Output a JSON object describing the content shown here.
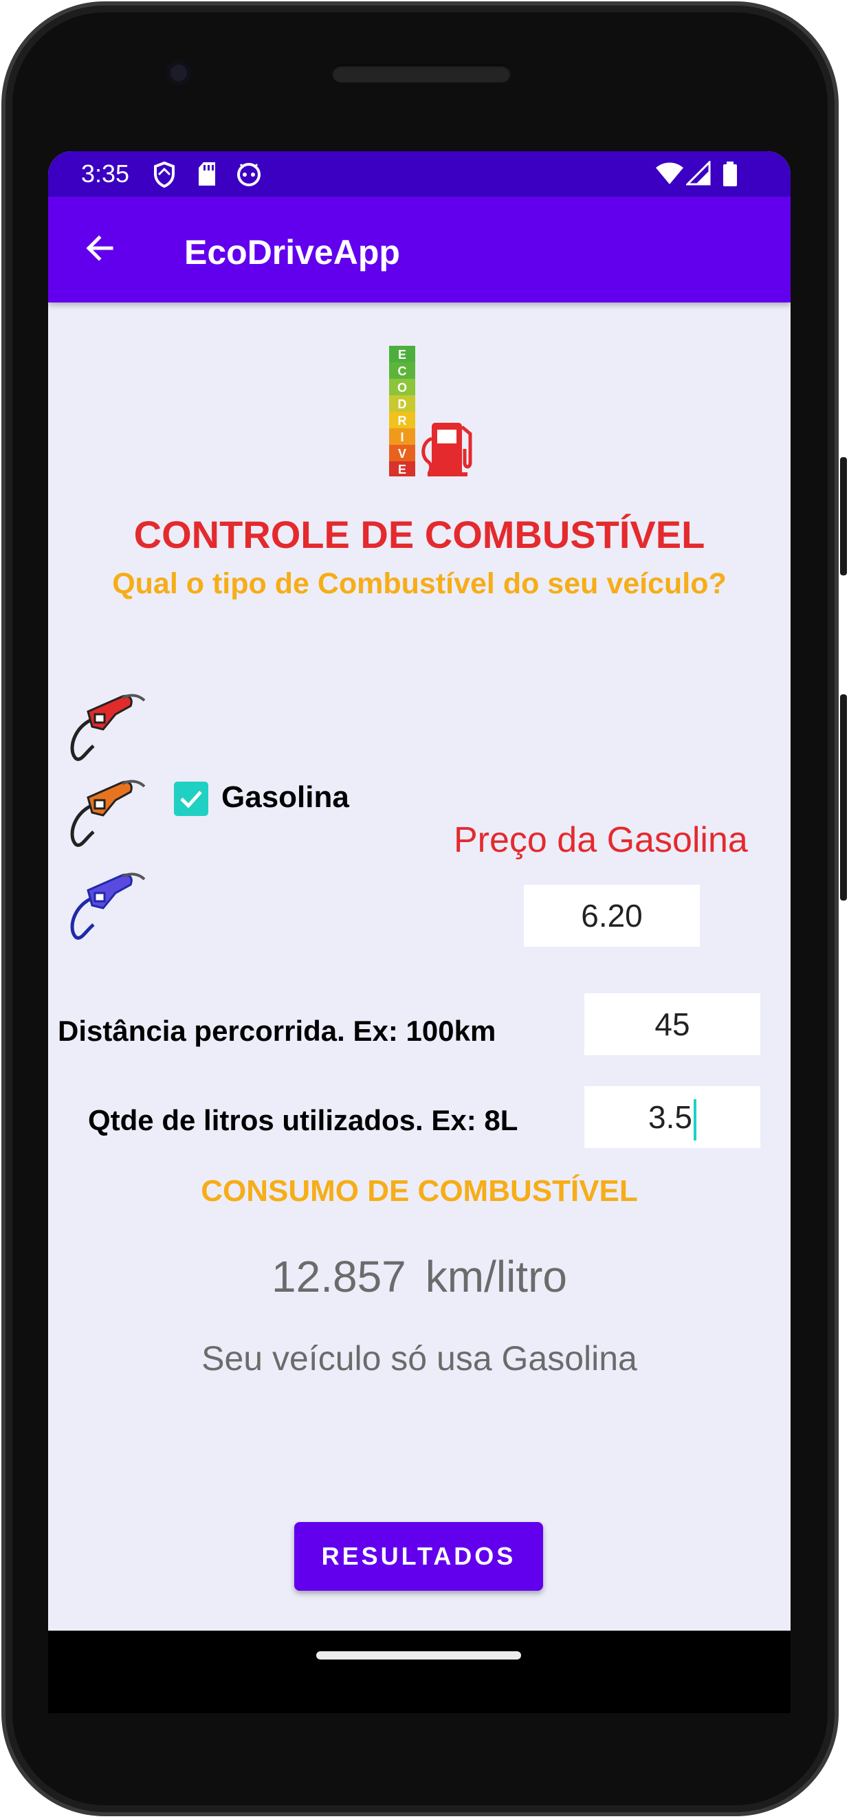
{
  "status_bar": {
    "time": "3:35",
    "left_icons": [
      "shield-icon",
      "sd-card-icon",
      "android-face-icon"
    ],
    "right_icons": [
      "wifi-icon",
      "signal-icon",
      "battery-icon"
    ]
  },
  "app_bar": {
    "title": "EcoDriveApp",
    "back_icon": "arrow-back-icon"
  },
  "logo": {
    "text": "ECODRIVE",
    "letters": [
      "E",
      "C",
      "O",
      "D",
      "R",
      "I",
      "V",
      "E"
    ],
    "icon": "fuel-pump-icon"
  },
  "header": {
    "title": "CONTROLE DE COMBUSTÍVEL",
    "subtitle": "Qual o tipo de Combustível do seu veículo?"
  },
  "fuel_options": {
    "nozzle_colors": [
      "#e02b2b",
      "#e8731f",
      "#5b4ae0"
    ],
    "selected": {
      "label": "Gasolina",
      "checked": true
    }
  },
  "price": {
    "label": "Preço da Gasolina",
    "value": "6.20"
  },
  "distance": {
    "label": "Distância percorrida. Ex: 100km",
    "value": "45"
  },
  "liters": {
    "label": "Qtde de litros utilizados. Ex: 8L",
    "value": "3.5"
  },
  "consumption": {
    "title": "CONSUMO DE COMBUSTÍVEL",
    "value": "12.857",
    "unit": "km/litro",
    "note": "Seu veículo só usa Gasolina"
  },
  "results_button": {
    "label": "RESULTADOS"
  },
  "colors": {
    "primary": "#6200ee",
    "status_bar": "#3b00c1",
    "red": "#e42a2d",
    "orange": "#f6ad17",
    "teal": "#20d0c3",
    "background": "#ecedf9"
  }
}
